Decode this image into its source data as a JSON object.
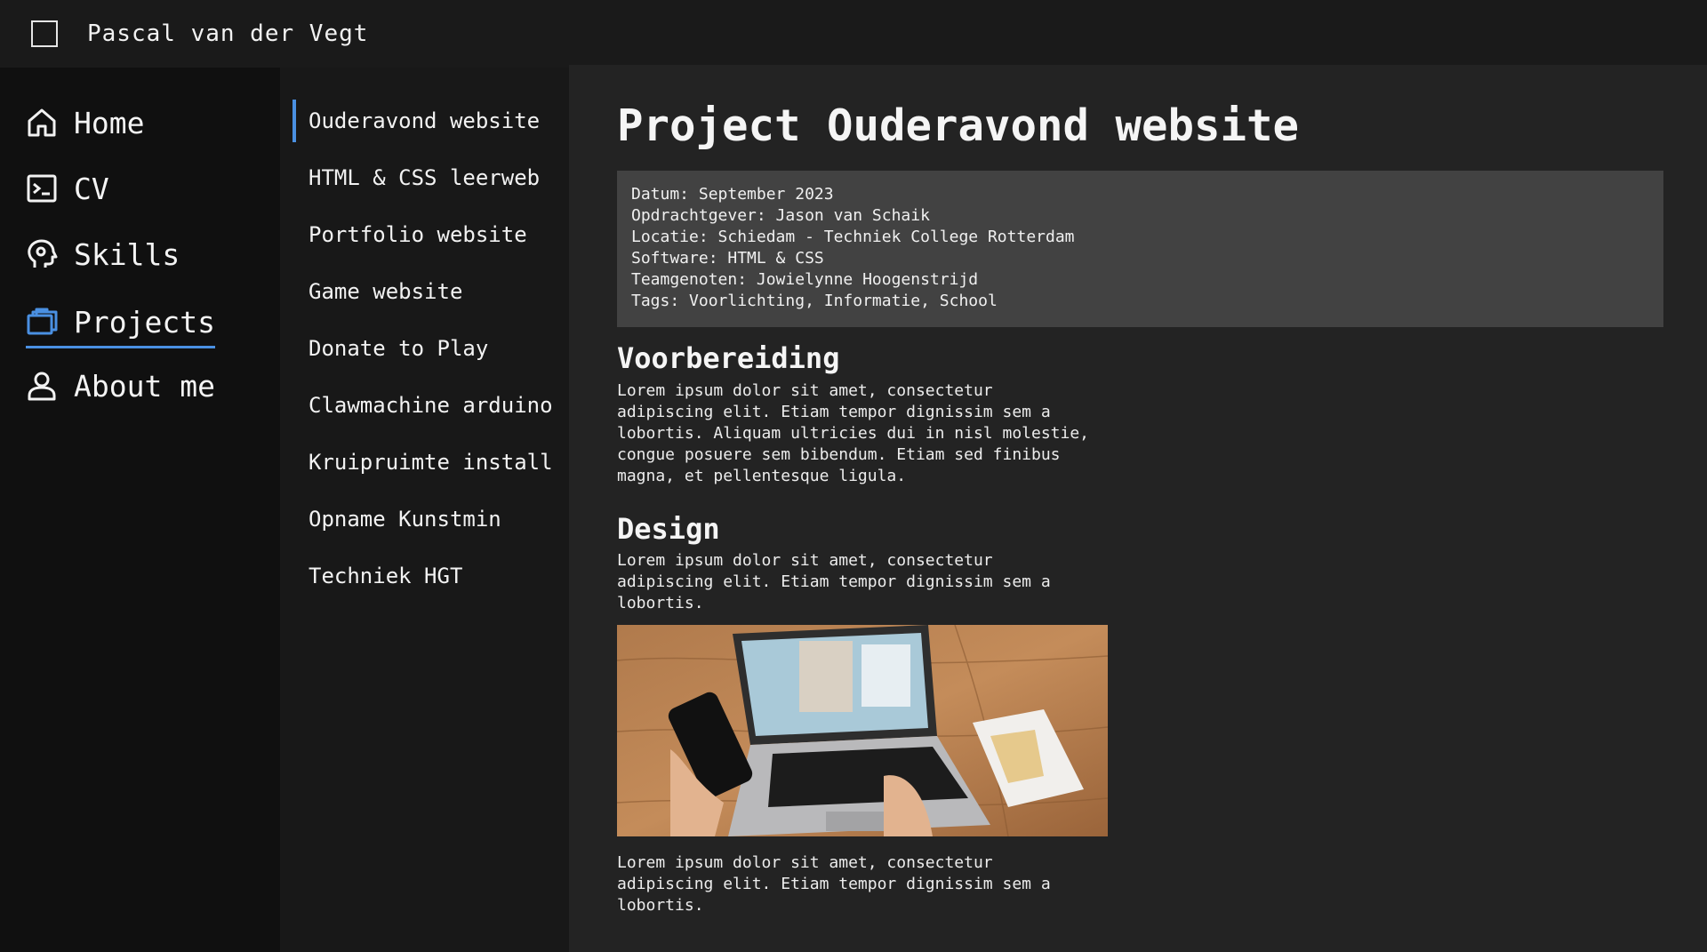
{
  "header": {
    "brand": "Pascal van der Vegt"
  },
  "sidebar": {
    "items": [
      {
        "label": "Home",
        "icon": "home-icon"
      },
      {
        "label": "CV",
        "icon": "terminal-icon"
      },
      {
        "label": "Skills",
        "icon": "head-gear-icon"
      },
      {
        "label": "Projects",
        "icon": "briefcase-icon",
        "active": true
      },
      {
        "label": "About me",
        "icon": "user-icon"
      }
    ]
  },
  "projects": {
    "items": [
      "Ouderavond website",
      "HTML & CSS leerweb",
      "Portfolio website",
      "Game website",
      "Donate to Play",
      "Clawmachine arduino",
      "Kruipruimte install",
      "Opname Kunstmin",
      "Techniek HGT"
    ],
    "active_index": 0
  },
  "main": {
    "title": "Project Ouderavond website",
    "info": [
      "Datum: September 2023",
      "Opdrachtgever: Jason van Schaik",
      "Locatie: Schiedam - Techniek College Rotterdam",
      "Software: HTML & CSS",
      "Teamgenoten: Jowielynne Hoogenstrijd",
      "Tags: Voorlichting, Informatie, School"
    ],
    "sections": [
      {
        "title": "Voorbereiding",
        "text": "Lorem ipsum dolor sit amet, consectetur adipiscing elit. Etiam tempor dignissim sem a lobortis. Aliquam ultricies dui in nisl molestie, congue posuere sem bibendum. Etiam sed finibus magna, et pellentesque ligula."
      },
      {
        "title": "Design",
        "text": "Lorem ipsum dolor sit amet, consectetur adipiscing elit. Etiam tempor dignissim sem a lobortis."
      }
    ],
    "caption": "Lorem ipsum dolor sit amet, consectetur adipiscing elit. Etiam tempor dignissim sem a lobortis."
  },
  "colors": {
    "accent": "#4a90e2",
    "topbar": "#1a1a1a",
    "sidebar": "#101010",
    "subnav": "#181818",
    "main": "#232323",
    "infobox": "#424242"
  }
}
